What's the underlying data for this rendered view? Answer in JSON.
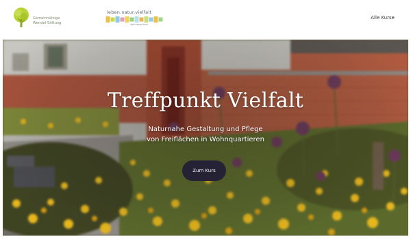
{
  "header": {
    "logo_left": {
      "lines": [
        "Gemeinnützige",
        "Wendel-Stiftung"
      ],
      "icon": "tree-icon"
    },
    "logo_center": {
      "title": "leben.natur.vielfalt",
      "subtitle": "Wohnquartiere",
      "block_colors": [
        "#e9c24a",
        "#c8d64a",
        "#8ecde0",
        "#e39ac0",
        "#f0d35a",
        "#9bd07a",
        "#b7dff0",
        "#e7b45c",
        "#c9e07a",
        "#98c8e8",
        "#e9c24a",
        "#a6d38a"
      ]
    },
    "nav": {
      "all_courses": "Alle Kurse"
    }
  },
  "hero": {
    "title": "Treffpunkt Vielfalt",
    "subtitle_lines": [
      "Naturnahe Gestaltung und Pflege",
      "von Freiflächen in Wohnquartieren"
    ],
    "cta_label": "Zum Kurs",
    "image": "garden-flowers-brick-building"
  },
  "colors": {
    "button_bg": "#262235",
    "logo_green": "#b7d334",
    "title_text": "#ffffff"
  }
}
